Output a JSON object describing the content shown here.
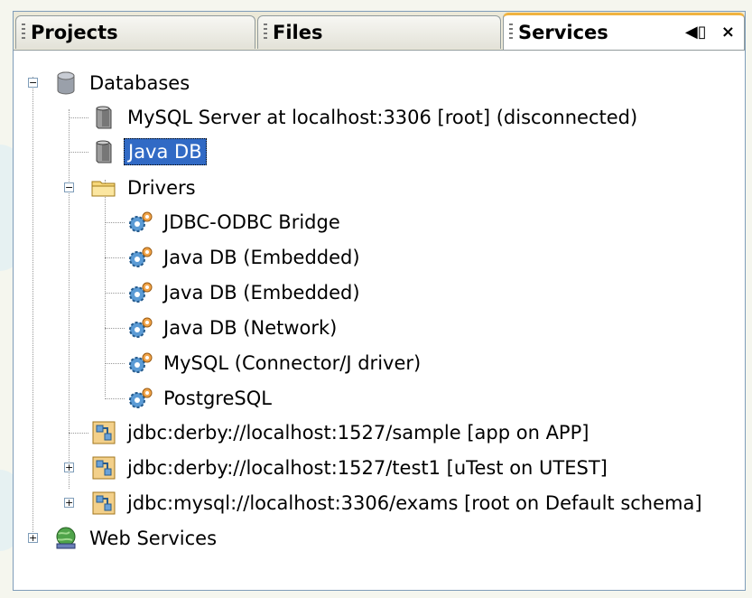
{
  "tabs": [
    {
      "label": "Projects"
    },
    {
      "label": "Files"
    },
    {
      "label": "Services"
    }
  ],
  "tab_controls": {
    "minimize": "◀▯",
    "close": "×"
  },
  "tree": {
    "databases": "Databases",
    "mysql_server": "MySQL Server at localhost:3306 [root] (disconnected)",
    "java_db": "Java DB",
    "drivers": "Drivers",
    "driver_items": [
      "JDBC-ODBC Bridge",
      "Java DB (Embedded)",
      "Java DB (Embedded)",
      "Java DB (Network)",
      "MySQL (Connector/J driver)",
      "PostgreSQL"
    ],
    "connections": [
      "jdbc:derby://localhost:1527/sample [app on APP]",
      "jdbc:derby://localhost:1527/test1 [uTest on UTEST]",
      "jdbc:mysql://localhost:3306/exams [root on Default schema]"
    ],
    "web_services": "Web Services"
  },
  "expander": {
    "expanded": "−",
    "collapsed": "+"
  }
}
